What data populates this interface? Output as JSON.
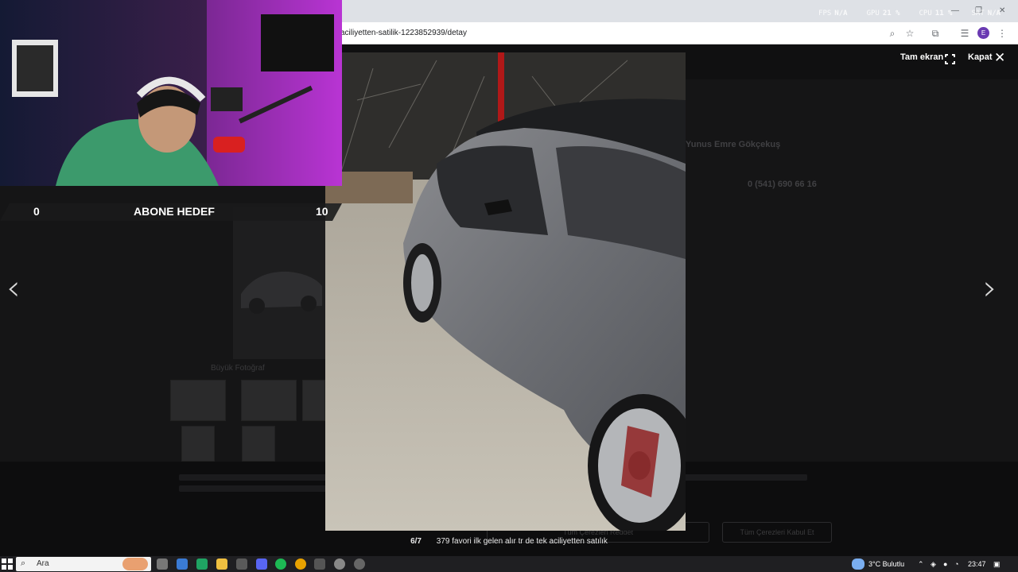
{
  "browser": {
    "url": "aciliyetten-satilik-1223852939/detay",
    "profile_initial": "E",
    "win_min": "—",
    "win_max": "❐",
    "win_close": "✕"
  },
  "overlay": {
    "fps_label": "FPS",
    "fps_val": "N/A",
    "gpu_label": "GPU",
    "gpu_val": "21 %",
    "cpu_label": "CPU",
    "cpu_val": "11 %",
    "sat_label": "SAT",
    "sat_val": "N/A"
  },
  "lightbox": {
    "listing_id_partial": "23852939",
    "fullscreen_label": "Tam ekran",
    "close_label": "Kapat",
    "counter": "6/7",
    "caption": "379 favori ilk gelen alır tr de tek aciliyetten satılık",
    "prev_arrow": "‹",
    "next_arrow": "›",
    "close_icon": "✕"
  },
  "stream": {
    "goal_current": "0",
    "goal_title": "ABONE HEDEF",
    "goal_target": "10"
  },
  "page_bg": {
    "seller_name": "Yunus Emre Gökçekuş",
    "phone": "0 (541) 690 66 16",
    "big_photo": "Büyük Fotoğraf",
    "accept_button": "Tüm Çerezleri Kabul Et",
    "cookie_button": "Tüm Çerezleri Reddet"
  },
  "taskbar": {
    "search_placeholder": "Ara",
    "weather": "3°C  Bulutlu",
    "time": "23:47"
  },
  "colors": {
    "accent": "#6a3ab2",
    "page_dim": "#151516",
    "chrome": "#dee1e6"
  }
}
